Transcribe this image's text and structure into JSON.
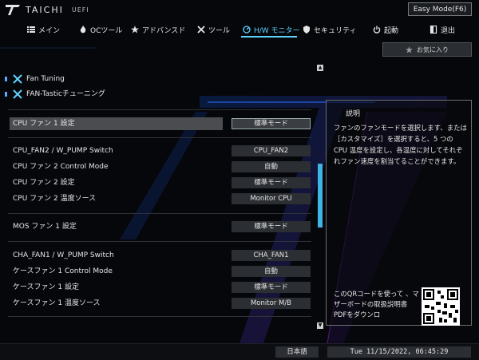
{
  "brand": {
    "name": "TAICHI",
    "sub": "UEFI"
  },
  "easy_mode": {
    "label": "Easy Mode(F6)"
  },
  "nav": {
    "items": [
      {
        "label": "メイン"
      },
      {
        "label": "OCツール"
      },
      {
        "label": "アドバンスド"
      },
      {
        "label": "ツール"
      },
      {
        "label": "H/W モニター"
      },
      {
        "label": "セキュリティ"
      },
      {
        "label": "起動"
      },
      {
        "label": "退出"
      }
    ]
  },
  "favorites": {
    "label": "お気に入り"
  },
  "list": {
    "fan_tuning": "Fan Tuning",
    "fan_tastic": "FAN-Tasticチューニング",
    "cpu_fan1": {
      "label": "CPU ファン 1 設定",
      "value": "標準モード"
    },
    "cpu_fan2_switch": {
      "label": "CPU_FAN2 / W_PUMP Switch",
      "value": "CPU_FAN2"
    },
    "cpu_fan2_control": {
      "label": "CPU ファン 2 Control Mode",
      "value": "自動"
    },
    "cpu_fan2_setting": {
      "label": "CPU ファン 2 設定",
      "value": "標準モード"
    },
    "cpu_fan2_source": {
      "label": "CPU ファン 2 温度ソース",
      "value": "Monitor CPU"
    },
    "mos_fan1": {
      "label": "MOS ファン 1 設定",
      "value": "標準モード"
    },
    "cha_fan1_switch": {
      "label": "CHA_FAN1 / W_PUMP Switch",
      "value": "CHA_FAN1"
    },
    "case_fan1_control": {
      "label": "ケースファン 1 Control Mode",
      "value": "自動"
    },
    "case_fan1_setting": {
      "label": "ケースファン 1 設定",
      "value": "標準モード"
    },
    "case_fan1_source": {
      "label": "ケースファン 1 温度ソース",
      "value": "Monitor M/B"
    }
  },
  "description": {
    "title": "説明",
    "text": "ファンのファンモードを選択します、または［カスタマイズ］を選択すると、5 つの CPU 温度を設定し、各温度に対してそれぞれファン速度を割当てることができます。",
    "qr_text": "このQRコードを使って 、マザーボードの取扱説明書PDFをダウンロ"
  },
  "footer": {
    "language": "日本語",
    "datetime": "Tue 11/15/2022, 06:45:29"
  },
  "colors": {
    "accent": "#5fd3ff",
    "scroll": "#3fb5e6"
  }
}
